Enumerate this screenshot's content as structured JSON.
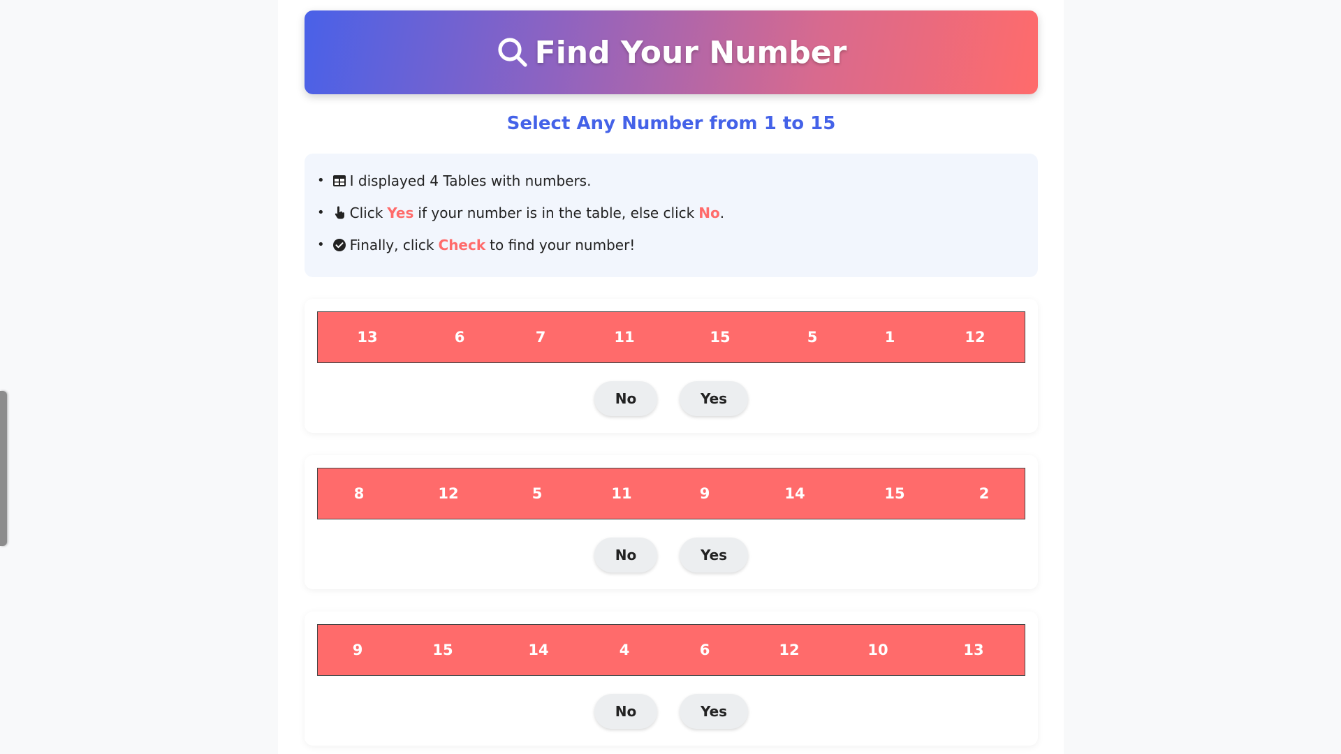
{
  "header": {
    "title": "Find Your Number",
    "icon": "search-icon"
  },
  "subtitle": "Select Any Number from 1 to 15",
  "instructions": {
    "line1": {
      "icon": "table-icon",
      "text": "I displayed 4 Tables with numbers."
    },
    "line2": {
      "icon": "pointer-hand-icon",
      "pre": "Click",
      "yes": "Yes",
      "mid": "if your number is in the table, else click",
      "no": "No",
      "post": "."
    },
    "line3": {
      "icon": "check-circle-icon",
      "pre": "Finally, click",
      "check": "Check",
      "post": "to find your number!"
    }
  },
  "tables": [
    {
      "numbers": [
        "13",
        "6",
        "7",
        "11",
        "15",
        "5",
        "1",
        "12"
      ],
      "no_label": "No",
      "yes_label": "Yes"
    },
    {
      "numbers": [
        "8",
        "12",
        "5",
        "11",
        "9",
        "14",
        "15",
        "2"
      ],
      "no_label": "No",
      "yes_label": "Yes"
    },
    {
      "numbers": [
        "9",
        "15",
        "14",
        "4",
        "6",
        "12",
        "10",
        "13"
      ],
      "no_label": "No",
      "yes_label": "Yes"
    }
  ],
  "colors": {
    "accent": "#ff6b6b",
    "primary": "#4462e8",
    "card_bg": "#f2f6fd"
  }
}
